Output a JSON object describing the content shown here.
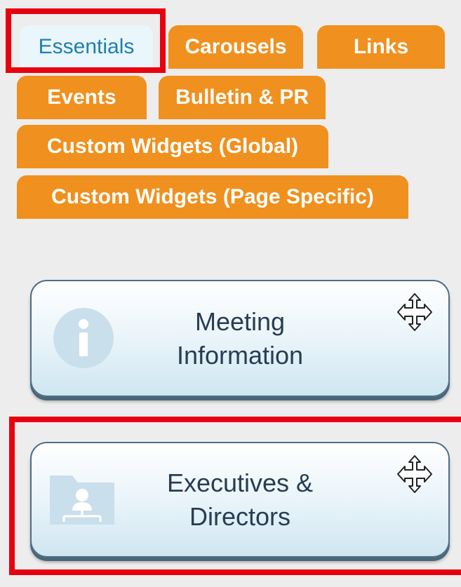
{
  "tabs": [
    {
      "label": "Essentials",
      "active": true
    },
    {
      "label": "Carousels",
      "active": false
    },
    {
      "label": "Links",
      "active": false
    },
    {
      "label": "Events",
      "active": false
    },
    {
      "label": "Bulletin & PR",
      "active": false
    },
    {
      "label": "Custom Widgets (Global)",
      "active": false
    },
    {
      "label": "Custom Widgets (Page Specific)",
      "active": false
    }
  ],
  "widgets": [
    {
      "line1": "Meeting",
      "line2": "Information",
      "icon": "info-icon"
    },
    {
      "line1": "Executives &",
      "line2": "Directors",
      "icon": "org-folder-icon"
    }
  ],
  "colors": {
    "tab_orange": "#f0901e",
    "tab_active_bg": "#e9f6fb",
    "tab_active_text": "#1f7fae",
    "highlight_red": "#e8000f",
    "widget_text": "#283d52"
  }
}
